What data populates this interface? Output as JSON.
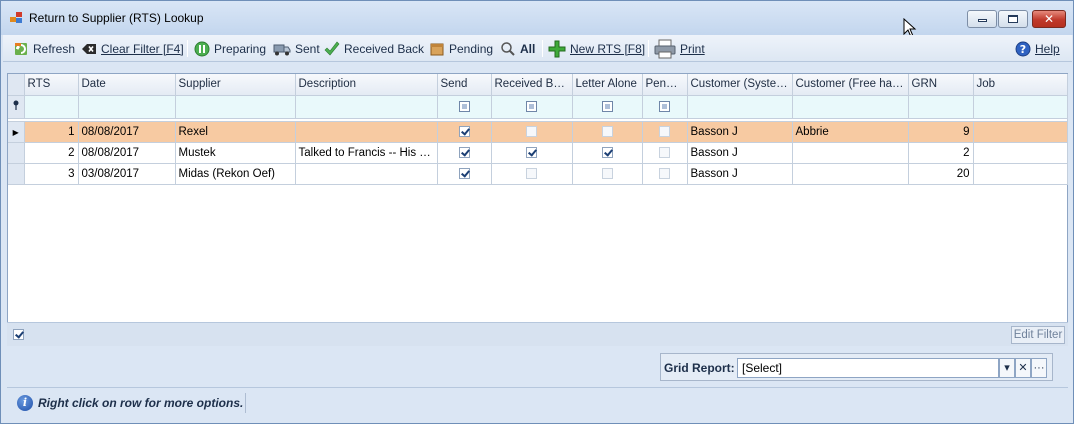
{
  "window": {
    "title": "Return to Supplier (RTS) Lookup"
  },
  "toolbar": {
    "refresh": "Refresh",
    "clear_filter": "Clear Filter [F4]",
    "preparing": "Preparing",
    "sent": "Sent",
    "received_back": "Received Back",
    "pending": "Pending",
    "all": "All",
    "new_rts": "New RTS [F8]",
    "print": "Print",
    "help": "Help"
  },
  "grid": {
    "columns": [
      "RTS",
      "Date",
      "Supplier",
      "Description",
      "Send",
      "Received Back",
      "Letter Alone",
      "Pending",
      "Customer (System)",
      "Customer (Free hand)",
      "GRN",
      "Job"
    ],
    "rows": [
      {
        "rts": "1",
        "date": "08/08/2017",
        "supplier": "Rexel",
        "description": "",
        "send": true,
        "received_back": false,
        "letter_alone": false,
        "pending": false,
        "customer_system": "Basson J",
        "customer_free": "Abbrie",
        "grn": "9",
        "job": ""
      },
      {
        "rts": "2",
        "date": "08/08/2017",
        "supplier": "Mustek",
        "description": "Talked to Francis -- His re...",
        "send": true,
        "received_back": true,
        "letter_alone": true,
        "pending": false,
        "customer_system": "Basson J",
        "customer_free": "",
        "grn": "2",
        "job": ""
      },
      {
        "rts": "3",
        "date": "03/08/2017",
        "supplier": "Midas (Rekon Oef)",
        "description": "",
        "send": true,
        "received_back": false,
        "letter_alone": false,
        "pending": false,
        "customer_system": "Basson J",
        "customer_free": "",
        "grn": "20",
        "job": ""
      }
    ]
  },
  "footer": {
    "edit_filter": "Edit Filter"
  },
  "report": {
    "label": "Grid Report:",
    "value": "[Select]"
  },
  "status": {
    "message": "Right click on row for more options."
  },
  "colors": {
    "selected_row": "#f7caa2",
    "filter_row": "#e9f9fb",
    "close_button": "#c0392b"
  }
}
